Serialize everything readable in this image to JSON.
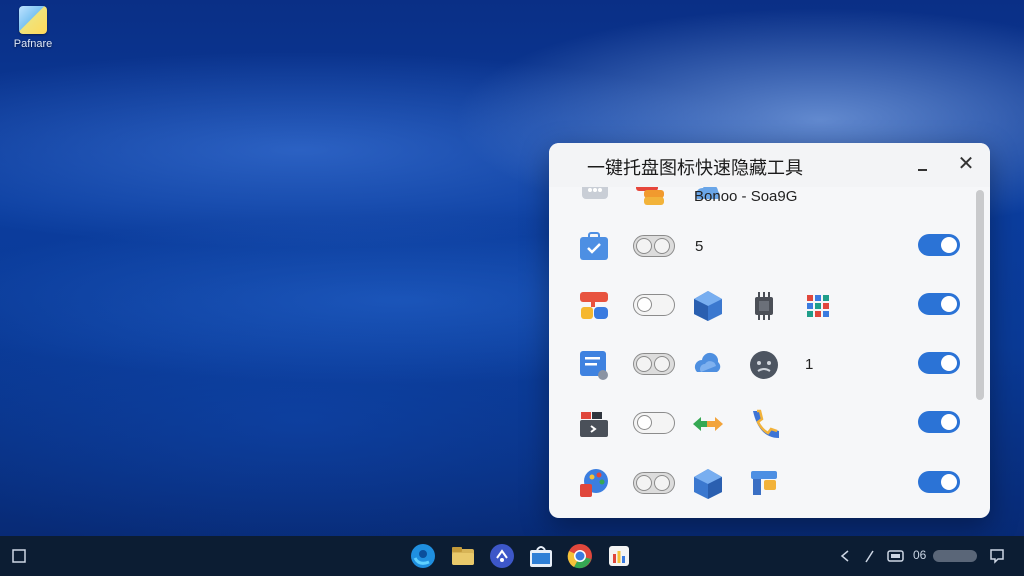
{
  "desktop": {
    "icons": [
      {
        "label": "Pafnare",
        "icon": "image-file-icon"
      }
    ]
  },
  "window": {
    "title": "一键托盘图标快速隐藏工具",
    "minimize_label": "–",
    "close_label": "✕",
    "rows": [
      {
        "app_icon": "chat-bubble-icon",
        "tray_icons": [
          "layers-icon",
          "cloud-icon"
        ],
        "text": "Bonoo - Soa9G"
      },
      {
        "app_icon": "briefcase-icon",
        "toggle": "gray",
        "text": "5",
        "visible": true
      },
      {
        "app_icon": "shapes-icon",
        "toggle": "off",
        "tray_icons": [
          "cube-icon",
          "chip-icon",
          "grid-icon"
        ],
        "visible": true
      },
      {
        "app_icon": "notes-icon",
        "toggle": "gray",
        "tray_icons": [
          "cloud-icon",
          "face-icon"
        ],
        "text": "1",
        "visible": true
      },
      {
        "app_icon": "terminal-icon",
        "toggle": "off",
        "tray_icons": [
          "arrows-icon",
          "phone-icon"
        ],
        "visible": true
      },
      {
        "app_icon": "palette-icon",
        "toggle": "gray",
        "tray_icons": [
          "cube-icon",
          "puzzle-icon"
        ],
        "visible": true
      }
    ]
  },
  "taskbar": {
    "tray_text": "06"
  }
}
